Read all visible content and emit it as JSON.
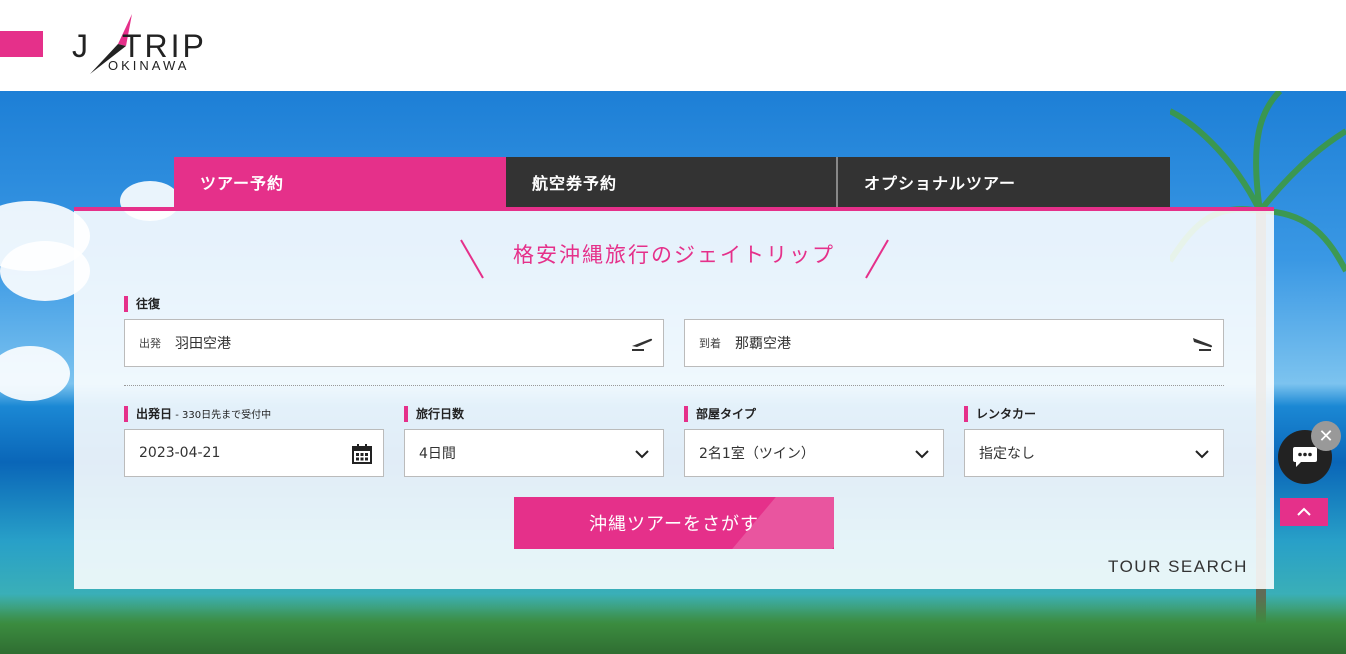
{
  "brand": {
    "logo_main_left": "J",
    "logo_main_right": "TRIP",
    "logo_sub": "OKINAWA",
    "accent_color": "#e5308a"
  },
  "tabs": [
    {
      "label": "ツアー予約",
      "active": true
    },
    {
      "label": "航空券予約",
      "active": false
    },
    {
      "label": "オプショナルツアー",
      "active": false
    }
  ],
  "panel": {
    "title": "格安沖縄旅行のジェイトリップ",
    "route": {
      "label": "往復",
      "departure": {
        "prefix": "出発",
        "value": "羽田空港",
        "icon": "plane-takeoff-icon"
      },
      "arrival": {
        "prefix": "到着",
        "value": "那覇空港",
        "icon": "plane-landing-icon"
      }
    },
    "date": {
      "label": "出発日",
      "note": " - 330日先まで受付中",
      "value": "2023-04-21",
      "icon": "calendar-icon"
    },
    "days": {
      "label": "旅行日数",
      "value": "4日間"
    },
    "room": {
      "label": "部屋タイプ",
      "value": "2名1室（ツイン）"
    },
    "rentacar": {
      "label": "レンタカー",
      "value": "指定なし"
    },
    "search_button": "沖縄ツアーをさがす",
    "caption": "TOUR SEARCH"
  },
  "widgets": {
    "chat_icon": "chat-icon",
    "close_glyph": "✕",
    "top_icon": "chevron-up-icon"
  }
}
